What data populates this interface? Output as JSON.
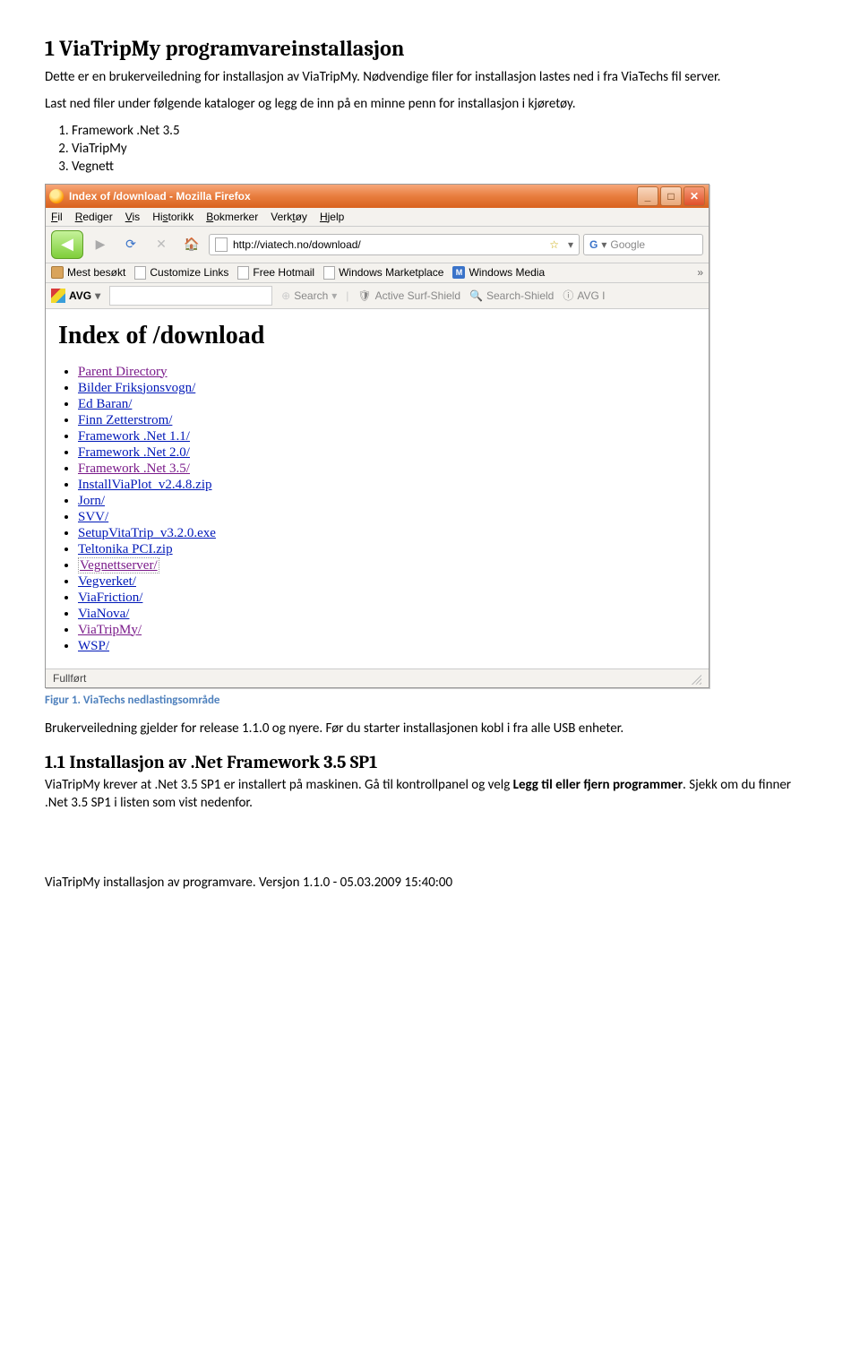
{
  "doc": {
    "h1": "1   ViaTripMy programvareinstallasjon",
    "p1": "Dette er en brukerveiledning for installasjon av ViaTripMy. Nødvendige filer for installasjon lastes ned i fra ViaTechs fil server.",
    "p2": "Last ned filer under følgende kataloger og legg de inn på en minne penn for installasjon i kjøretøy.",
    "ol": [
      "Framework .Net 3.5",
      "ViaTripMy",
      "Vegnett"
    ],
    "figcaption": "Figur 1. ViaTechs nedlastingsområde",
    "p3": "Brukerveiledning gjelder for release 1.1.0 og nyere. Før du starter installasjonen kobl i fra alle USB enheter.",
    "h2": "1.1   Installasjon av .Net Framework 3.5 SP1",
    "p4a": "ViaTripMy krever at .Net 3.5 SP1 er installert på maskinen.  Gå til kontrollpanel og velg ",
    "p4b": "Legg til eller fjern programmer",
    "p4c": ". Sjekk om du finner .Net 3.5 SP1 i listen som vist nedenfor.",
    "footer": "ViaTripMy installasjon av programvare.  Versjon 1.1.0 - 05.03.2009 15:40:00"
  },
  "browser": {
    "title": "Index of /download - Mozilla Firefox",
    "menus": [
      "Fil",
      "Rediger",
      "Vis",
      "Historikk",
      "Bokmerker",
      "Verktøy",
      "Hjelp"
    ],
    "url": "http://viatech.no/download/",
    "search_placeholder": "Google",
    "bookmarks": [
      "Mest besøkt",
      "Customize Links",
      "Free Hotmail",
      "Windows Marketplace",
      "Windows Media"
    ],
    "avg": {
      "label": "AVG",
      "search": "Search",
      "shield": "Active Surf-Shield",
      "searchshield": "Search-Shield",
      "avgi": "AVG I"
    },
    "content_heading": "Index of /download",
    "links": [
      {
        "label": "Parent Directory",
        "cls": "visited2"
      },
      {
        "label": "Bilder Friksjonsvogn/",
        "cls": ""
      },
      {
        "label": "Ed Baran/",
        "cls": ""
      },
      {
        "label": "Finn Zetterstrom/",
        "cls": ""
      },
      {
        "label": "Framework .Net 1.1/",
        "cls": ""
      },
      {
        "label": "Framework .Net 2.0/",
        "cls": ""
      },
      {
        "label": "Framework .Net 3.5/",
        "cls": "visited2"
      },
      {
        "label": "InstallViaPlot_v2.4.8.zip",
        "cls": ""
      },
      {
        "label": "Jorn/",
        "cls": ""
      },
      {
        "label": "SVV/",
        "cls": ""
      },
      {
        "label": "SetupVitaTrip_v3.2.0.exe",
        "cls": ""
      },
      {
        "label": "Teltonika PCI.zip",
        "cls": ""
      },
      {
        "label": "Vegnettserver/",
        "cls": "visited"
      },
      {
        "label": "Vegverket/",
        "cls": ""
      },
      {
        "label": "ViaFriction/",
        "cls": ""
      },
      {
        "label": "ViaNova/",
        "cls": ""
      },
      {
        "label": "ViaTripMy/",
        "cls": "visited2"
      },
      {
        "label": "WSP/",
        "cls": ""
      }
    ],
    "status": "Fullført"
  }
}
